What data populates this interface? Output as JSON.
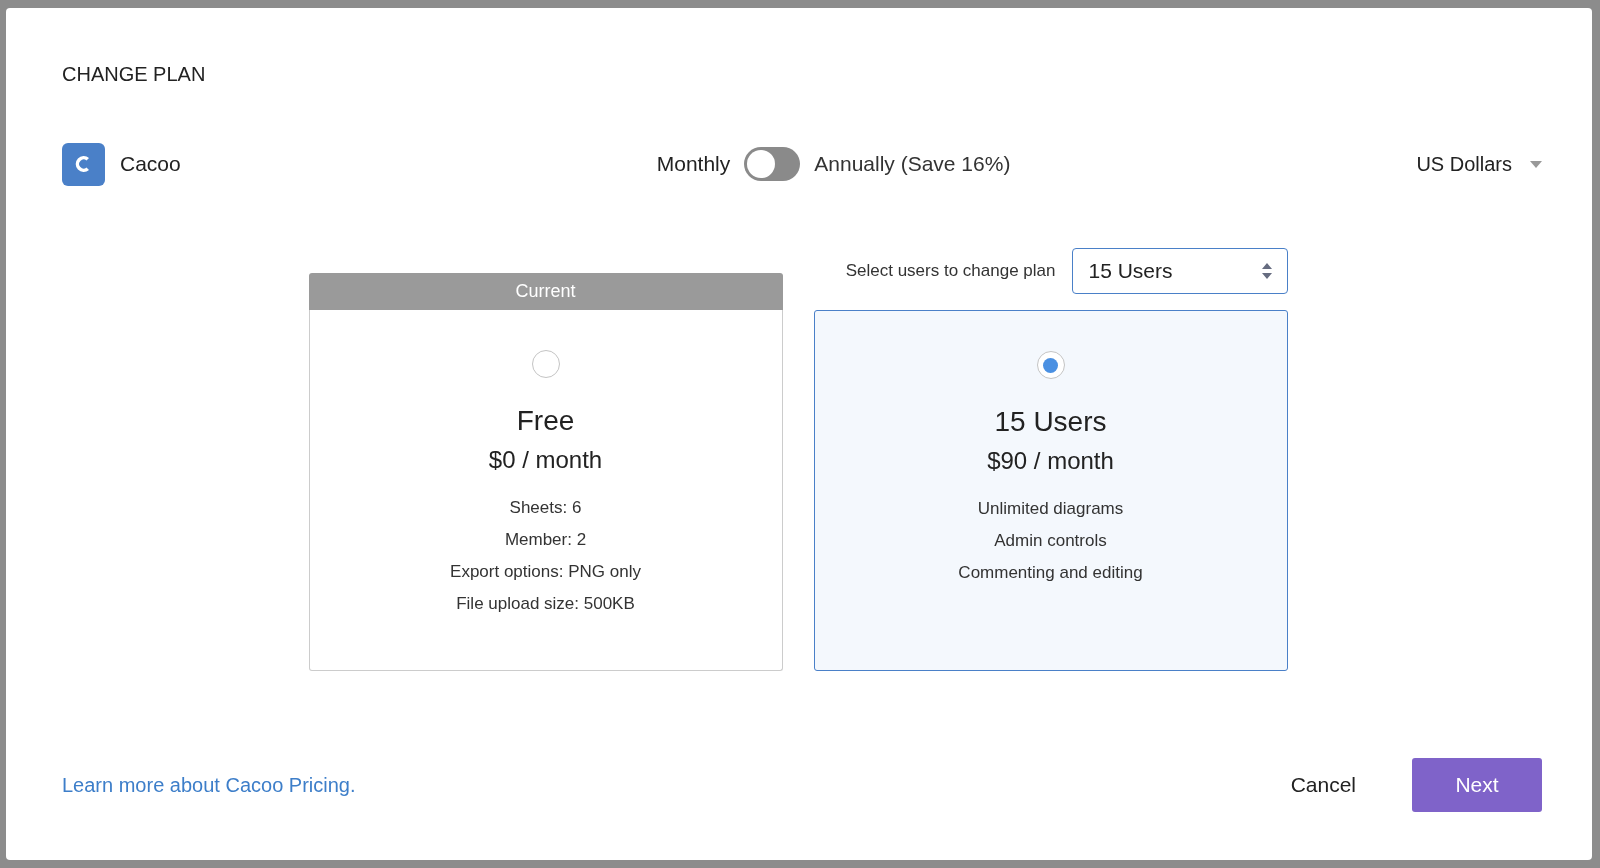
{
  "dialog": {
    "title": "CHANGE PLAN"
  },
  "brand": {
    "name": "Cacoo"
  },
  "billing": {
    "monthly_label": "Monthly",
    "annual_label": "Annually (Save 16%)",
    "annual_on": false
  },
  "currency": {
    "value": "US Dollars"
  },
  "user_select": {
    "label": "Select users to change plan",
    "value": "15 Users"
  },
  "plans": [
    {
      "header": "Current",
      "selected": false,
      "name": "Free",
      "price": "$0 / month",
      "features": [
        "Sheets: 6",
        "Member: 2",
        "Export options: PNG only",
        "File upload size: 500KB"
      ]
    },
    {
      "selected": true,
      "name": "15 Users",
      "price": "$90 / month",
      "features": [
        "Unlimited diagrams",
        "Admin controls",
        "Commenting and editing"
      ]
    }
  ],
  "footer": {
    "link": "Learn more about Cacoo Pricing.",
    "buttons": [
      {
        "label": "Cancel",
        "kind": "secondary"
      },
      {
        "label": "Next",
        "kind": "primary"
      }
    ]
  }
}
